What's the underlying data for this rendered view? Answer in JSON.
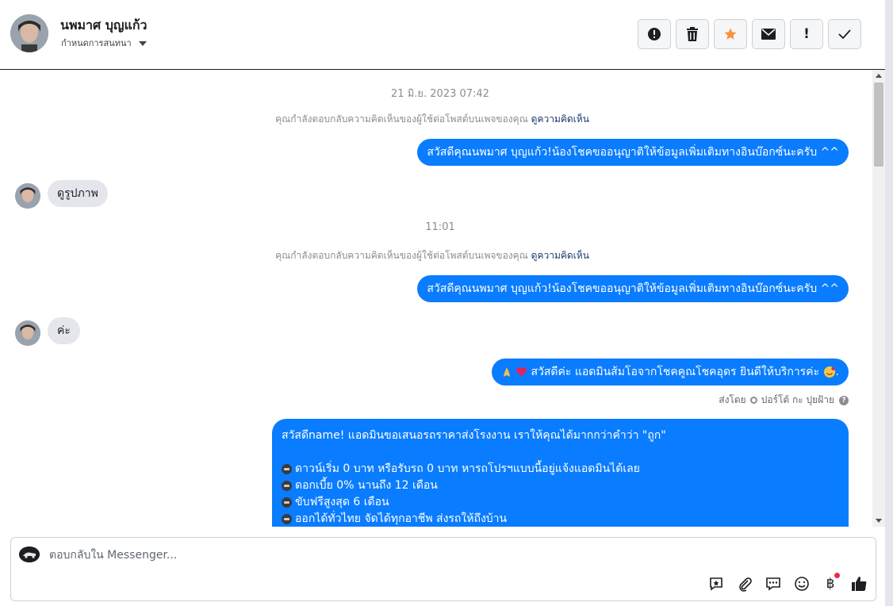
{
  "header": {
    "contact_name": "นพมาศ บุญแก้ว",
    "conversation_status": "กำหนดการสนทนา",
    "actions": [
      {
        "name": "mark-spam-button",
        "icon": "alert-circle-icon"
      },
      {
        "name": "delete-button",
        "icon": "trash-icon"
      },
      {
        "name": "star-button",
        "icon": "star-icon",
        "color": "#f7923a"
      },
      {
        "name": "mark-unread-button",
        "icon": "envelope-icon"
      },
      {
        "name": "follow-up-button",
        "icon": "exclamation-icon"
      },
      {
        "name": "mark-done-button",
        "icon": "check-icon"
      }
    ],
    "exclaim_label": "!"
  },
  "chat": {
    "timestamp_1": "21 มิ.ย. 2023 07:42",
    "system_note_1": "คุณกำลังตอบกลับความคิดเห็นของผู้ใช้ต่อโพสต์บนเพจของคุณ",
    "system_link_1": "ดูความคิดเห็น",
    "out_msg_1": "สวัสดีคุณนพมาศ บุญแก้ว!น้องโชคขออนุญาติให้ข้อมูลเพิ่มเติมทางอินบ๊อกซ์นะครับ ^^",
    "in_msg_1": "ดูรูปภาพ",
    "timestamp_2": "11:01",
    "system_note_2": "คุณกำลังตอบกลับความคิดเห็นของผู้ใช้ต่อโพสต์บนเพจของคุณ",
    "system_link_2": "ดูความคิดเห็น",
    "out_msg_2": "สวัสดีคุณนพมาศ บุญแก้ว!น้องโชคขออนุญาติให้ข้อมูลเพิ่มเติมทางอินบ๊อกซ์นะครับ ^^",
    "in_msg_2": "ค่ะ",
    "out_msg_3": "สวัสดีค่ะ แอดมินส้มโอจากโชคคูณโชคอุดร ยินดีให้บริการค่ะ",
    "out_msg_3_end": ".",
    "sent_by_prefix": "ส่งโดย",
    "sent_by_name": "ปอร์โต้ กะ ปุยฝ้าย",
    "promo": {
      "greeting": "สวัสดีname! แอดมินขอเสนอรถราคาส่งโรงงาน เราให้คุณได้มากกว่าคำว่า \"ถูก\"",
      "lines": [
        "ดาวน์เริ่ม 0 บาท หรือรับรถ 0 บาท หารถโปรฯแบบนี้อยู่แจ้งแอดมินได้เลย",
        "ดอกเบี้ย 0% นานถึง 12 เดือน",
        "ขับฟรีสูงสุด 6 เดือน",
        "ออกได้ทั่วไทย จัดได้ทุกอาชีพ ส่งรถให้ถึงบ้าน"
      ]
    }
  },
  "composer": {
    "placeholder": "ตอบกลับใน Messenger...",
    "tools": [
      "saved-reply-icon",
      "paperclip-icon",
      "chat-bubble-icon",
      "emoji-icon",
      "baht-payment-icon",
      "thumbs-up-icon"
    ],
    "baht_symbol": "฿",
    "notification_color": "#f02849"
  },
  "colors": {
    "outgoing_bubble": "#0a7cff",
    "incoming_bubble": "#e4e6eb",
    "link": "#1b3a6d"
  }
}
